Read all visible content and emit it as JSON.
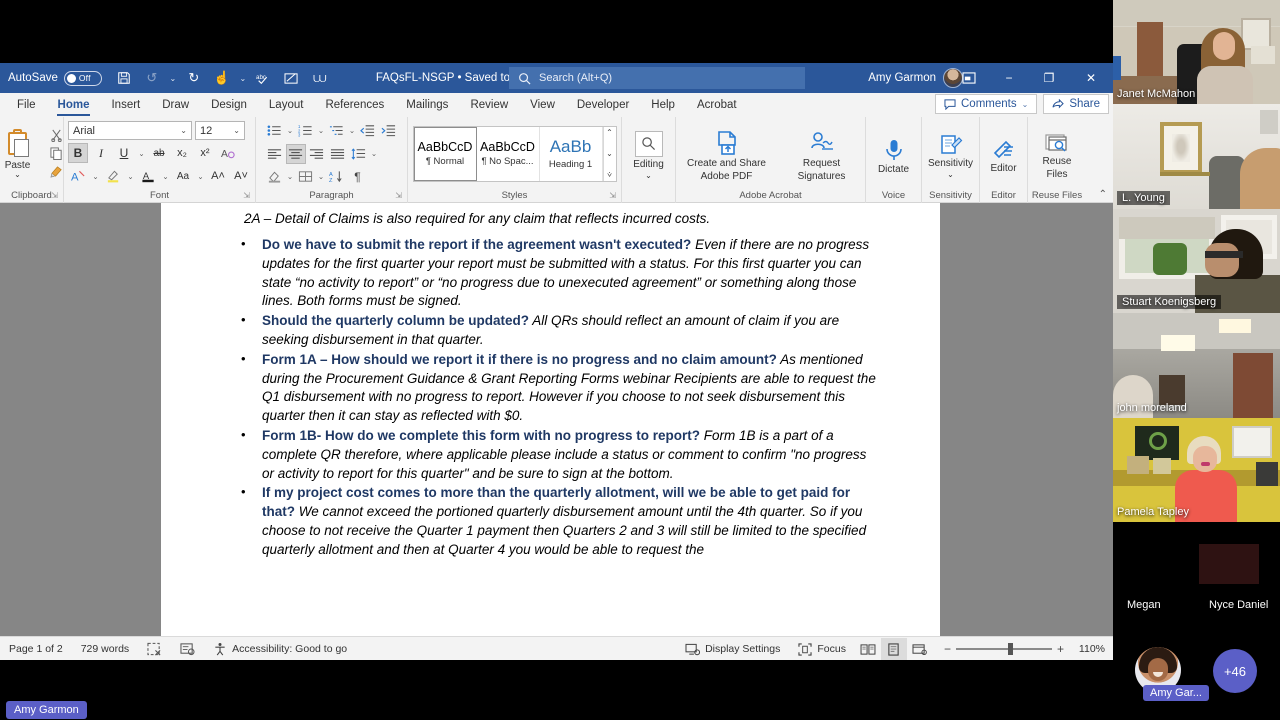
{
  "titlebar": {
    "autosave_label": "AutoSave",
    "autosave_state": "Off",
    "document_title": "FAQsFL-NSGP • Saved to J: Drive",
    "search_placeholder": "Search (Alt+Q)",
    "user_name": "Amy Garmon",
    "ribbon_display_icon": "ribbon-display-options-icon",
    "minimize": "−",
    "restore": "❐",
    "close": "✕",
    "qat": [
      {
        "name": "save-icon",
        "glyph": "💾"
      },
      {
        "name": "undo-icon",
        "glyph": "↺"
      },
      {
        "name": "redo-icon",
        "glyph": "↻"
      },
      {
        "name": "touch-mode-icon",
        "glyph": "☝"
      },
      {
        "name": "spelling-check-icon",
        "glyph": "abc"
      },
      {
        "name": "track-changes-icon",
        "glyph": "✎"
      },
      {
        "name": "customize-quick-access-toolbar-icon",
        "glyph": "⩊"
      }
    ]
  },
  "ribbon": {
    "tabs": [
      {
        "label": "File",
        "active": false
      },
      {
        "label": "Home",
        "active": true
      },
      {
        "label": "Insert",
        "active": false
      },
      {
        "label": "Draw",
        "active": false
      },
      {
        "label": "Design",
        "active": false
      },
      {
        "label": "Layout",
        "active": false
      },
      {
        "label": "References",
        "active": false
      },
      {
        "label": "Mailings",
        "active": false
      },
      {
        "label": "Review",
        "active": false
      },
      {
        "label": "View",
        "active": false
      },
      {
        "label": "Developer",
        "active": false
      },
      {
        "label": "Help",
        "active": false
      },
      {
        "label": "Acrobat",
        "active": false
      }
    ],
    "comments_label": "Comments",
    "share_label": "Share",
    "groups": {
      "clipboard": {
        "label": "Clipboard",
        "paste_label": "Paste"
      },
      "font": {
        "label": "Font",
        "font_name": "Arial",
        "font_size": "12",
        "bold": "B",
        "italic": "I",
        "underline": "U",
        "strikethrough": "ab",
        "subscript": "x₂",
        "superscript": "x²",
        "text_effects": "A",
        "highlight": "A",
        "font_color": "A",
        "change_case": "Aa",
        "grow_font": "A˄",
        "shrink_font": "A˅",
        "clear_formatting": "A"
      },
      "paragraph": {
        "label": "Paragraph"
      },
      "styles": {
        "label": "Styles",
        "items": [
          {
            "preview": "AaBbCcD",
            "name": "¶ Normal",
            "selected": true
          },
          {
            "preview": "AaBbCcD",
            "name": "¶ No Spac...",
            "selected": false
          },
          {
            "preview": "AaBb",
            "name": "Heading 1",
            "selected": false
          }
        ]
      },
      "editing": {
        "label": "Editing",
        "button": "Editing"
      },
      "acrobat": {
        "label": "Adobe Acrobat",
        "create_share_label": "Create and Share\nAdobe PDF",
        "create_share_line1": "Create and Share",
        "create_share_line2": "Adobe PDF",
        "request_sig_line1": "Request",
        "request_sig_line2": "Signatures"
      },
      "voice": {
        "label": "Voice",
        "dictate": "Dictate"
      },
      "sensitivity": {
        "label": "Sensitivity",
        "button": "Sensitivity"
      },
      "editor_group": {
        "label": "Editor",
        "button": "Editor"
      },
      "reuse": {
        "label": "Reuse Files",
        "line1": "Reuse",
        "line2": "Files"
      }
    }
  },
  "document": {
    "intro_line": "2A – Detail of Claims is also required for any claim that reflects incurred costs.",
    "faqs": [
      {
        "question": "Do we have to submit the report if the agreement wasn't executed?",
        "answer": "  Even if there are no progress updates for the first quarter your report must be submitted with a status. For this first quarter you can state “no activity to report” or “no progress due to unexecuted agreement” or something along those lines. Both forms must be signed."
      },
      {
        "question": "Should the quarterly column be updated?",
        "answer": " All QRs should reflect an amount of claim if you are seeking disbursement in that quarter."
      },
      {
        "question": " Form 1A – How should we report it if there is no progress and no claim amount?",
        "answer": "    As mentioned during the Procurement Guidance & Grant Reporting Forms webinar Recipients are able to request the Q1 disbursement with no progress to report. However if you choose to not seek disbursement this quarter then it can stay as reflected with $0."
      },
      {
        "question": "Form 1B-  How do we complete this form with no progress to report?",
        "answer": " Form 1B is a part of a complete QR therefore, where applicable please include a status or comment to confirm \"no progress or activity to report for this quarter\" and be sure to sign at the bottom."
      },
      {
        "question": "If my project cost comes to more than the quarterly allotment, will we be able to get paid for that?",
        "answer": " We cannot exceed the portioned quarterly disbursement amount until the 4th quarter. So if you choose to not receive the Quarter 1 payment then Quarters 2 and 3 will still be limited to the specified quarterly allotment and then at Quarter 4 you would be able to request the"
      }
    ]
  },
  "statusbar": {
    "page": "Page 1 of 2",
    "words": "729 words",
    "proofing_icon": "spelling-errors-icon",
    "language_icon": "language-icon",
    "accessibility": "Accessibility: Good to go",
    "display_settings": "Display Settings",
    "focus": "Focus",
    "view_read": "read-mode-icon",
    "view_print": "print-layout-icon",
    "view_web": "web-layout-icon",
    "zoom_out": "−",
    "zoom_in": "+",
    "zoom_level": "110%"
  },
  "meeting": {
    "active_speaker_chip": "Amy Garmon",
    "participants": [
      {
        "name": "Janet McMahon"
      },
      {
        "name": "L. Young"
      },
      {
        "name": "Stuart Koenigsberg"
      },
      {
        "name": "john moreland"
      },
      {
        "name": "Pamela Tapley"
      },
      {
        "name": "Megan"
      },
      {
        "name": "Nyce Daniel"
      }
    ],
    "self_chip": "Amy Gar...",
    "overflow_count": "+46"
  },
  "colors": {
    "word_blue": "#2b579a",
    "accent_link": "#1f3864",
    "teams_purple": "#5b5fc7"
  }
}
